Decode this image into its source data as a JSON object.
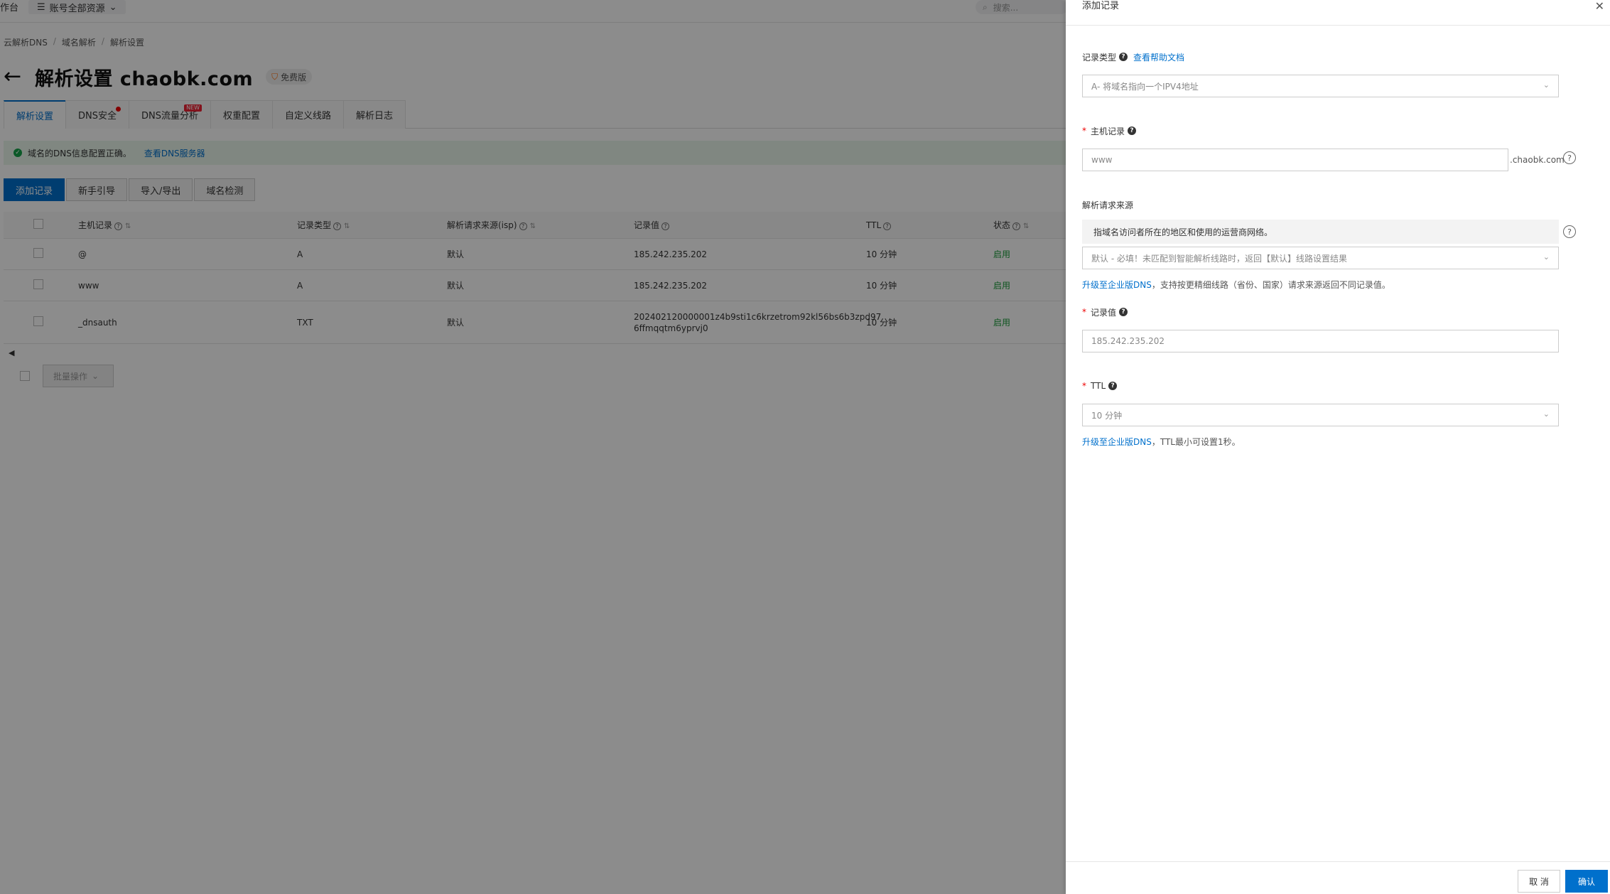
{
  "topbar": {
    "workbench": "作台",
    "resource_filter": "账号全部资源",
    "search_placeholder": "搜索..."
  },
  "breadcrumb": [
    "云解析DNS",
    "域名解析",
    "解析设置"
  ],
  "page": {
    "title": "解析设置 chaobk.com",
    "badge": "免费版"
  },
  "tabs": [
    {
      "label": "解析设置",
      "active": true
    },
    {
      "label": "DNS安全",
      "dot": true
    },
    {
      "label": "DNS流量分析",
      "tag": "NEW"
    },
    {
      "label": "权重配置"
    },
    {
      "label": "自定义线路"
    },
    {
      "label": "解析日志"
    }
  ],
  "alert": {
    "text": "域名的DNS信息配置正确。",
    "link": "查看DNS服务器"
  },
  "toolbar": {
    "add": "添加记录",
    "guide": "新手引导",
    "import_export": "导入/导出",
    "check": "域名检测"
  },
  "table": {
    "headers": {
      "host": "主机记录",
      "type": "记录类型",
      "isp": "解析请求来源(isp)",
      "value": "记录值",
      "ttl": "TTL",
      "status": "状态"
    },
    "rows": [
      {
        "host": "@",
        "type": "A",
        "isp": "默认",
        "value": "185.242.235.202",
        "value2": "",
        "ttl": "10 分钟",
        "status": "启用"
      },
      {
        "host": "www",
        "type": "A",
        "isp": "默认",
        "value": "185.242.235.202",
        "value2": "",
        "ttl": "10 分钟",
        "status": "启用"
      },
      {
        "host": "_dnsauth",
        "type": "TXT",
        "isp": "默认",
        "value": "202402120000001z4b9sti1c6krzetrom92kl56bs6b3zpd97",
        "value2": "6ffmqqtm6yprvj0",
        "ttl": "10 分钟",
        "status": "启用"
      }
    ]
  },
  "batch": {
    "label": "批量操作"
  },
  "drawer": {
    "title": "添加记录",
    "record_type": {
      "label": "记录类型",
      "help_link": "查看帮助文档",
      "value": "A- 将域名指向一个IPV4地址"
    },
    "host": {
      "label": "主机记录",
      "value": "www",
      "suffix": ".chaobk.com"
    },
    "source": {
      "label": "解析请求来源",
      "hint": "指域名访问者所在的地区和使用的运营商网络。",
      "value": "默认 - 必填！未匹配到智能解析线路时，返回【默认】线路设置结果",
      "upgrade_link": "升级至企业版DNS",
      "upgrade_text": "，支持按更精细线路（省份、国家）请求来源返回不同记录值。"
    },
    "record_value": {
      "label": "记录值",
      "value": "185.242.235.202"
    },
    "ttl": {
      "label": "TTL",
      "value": "10 分钟",
      "upgrade_link": "升级至企业版DNS",
      "upgrade_text": "，TTL最小可设置1秒。"
    },
    "footer": {
      "cancel": "取 消",
      "ok": "确认"
    }
  }
}
